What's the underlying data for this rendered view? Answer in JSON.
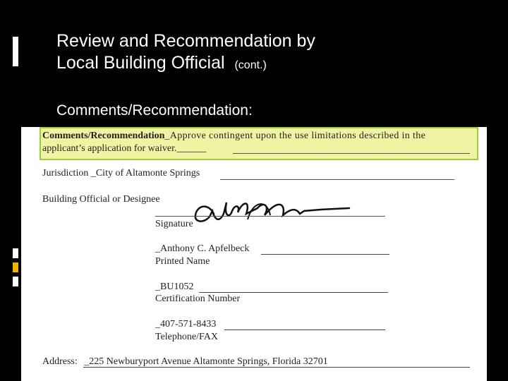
{
  "slide": {
    "title_line1": "Review and Recommendation by",
    "title_line2": "Local Building Official",
    "title_suffix": "(cont.)",
    "subtitle": "Comments/Recommendation:"
  },
  "document": {
    "comments_label": "Comments/Recommendation",
    "comments_text_line1": "_Approve contingent upon the use limitations described in the",
    "comments_text_line2": "applicant’s application for waiver.______",
    "jurisdiction_label": "Jurisdiction",
    "jurisdiction_value": "_City of Altamonte Springs",
    "official_label": "Building Official or Designee",
    "signature_label": "Signature",
    "printed_name_value": "_Anthony C. Apfelbeck",
    "printed_name_label": "Printed Name",
    "certification_value": "_BU1052",
    "certification_label": "Certification Number",
    "phone_value": "_407-571-8433",
    "phone_label": "Telephone/FAX",
    "address_label": "Address:",
    "address_value": "_225 Newburyport Avenue Altamonte Springs, Florida 32701"
  },
  "colors": {
    "highlight": "#f0f4a2",
    "highlight_border": "#9acd3a"
  }
}
